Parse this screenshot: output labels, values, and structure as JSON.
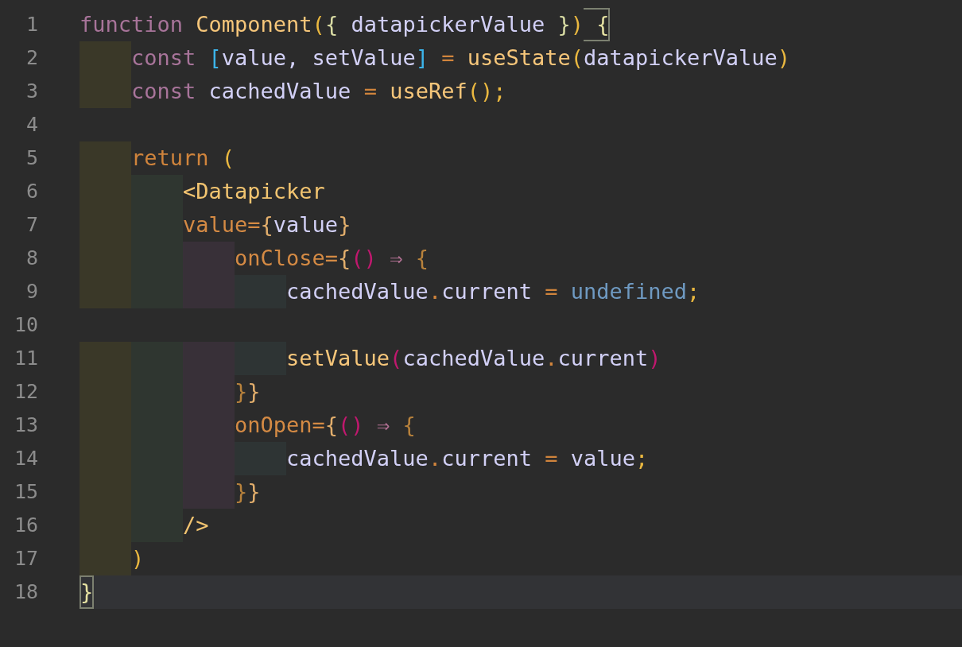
{
  "editor": {
    "lines": [
      {
        "number": "1",
        "current": false,
        "tokens": [
          {
            "text": "function",
            "kind": "keyword"
          },
          {
            "text": " Component",
            "kind": "function"
          },
          {
            "text": "(",
            "kind": "paren"
          },
          {
            "text": "{",
            "kind": "brace-pale"
          },
          {
            "text": " datapickerValue ",
            "kind": "variable"
          },
          {
            "text": "}",
            "kind": "brace-pale"
          },
          {
            "text": ")",
            "kind": "paren"
          },
          {
            "text": " {",
            "kind": "brace-match"
          }
        ]
      },
      {
        "number": "2",
        "current": false,
        "guides": [
          {
            "color": "#3a3828"
          }
        ],
        "tokens": [
          {
            "text": "const",
            "kind": "keyword"
          },
          {
            "text": " [",
            "kind": "bracket"
          },
          {
            "text": "value, setValue",
            "kind": "variable"
          },
          {
            "text": "]",
            "kind": "bracket"
          },
          {
            "text": " =",
            "kind": "operator"
          },
          {
            "text": " useState",
            "kind": "function"
          },
          {
            "text": "(",
            "kind": "paren"
          },
          {
            "text": "datapickerValue",
            "kind": "variable"
          },
          {
            "text": ")",
            "kind": "paren"
          }
        ]
      },
      {
        "number": "3",
        "current": false,
        "guides": [
          {
            "color": "#3a3828"
          }
        ],
        "tokens": [
          {
            "text": "const",
            "kind": "keyword"
          },
          {
            "text": " cachedValue",
            "kind": "variable"
          },
          {
            "text": " =",
            "kind": "operator"
          },
          {
            "text": " useRef",
            "kind": "function"
          },
          {
            "text": "();",
            "kind": "paren"
          }
        ]
      },
      {
        "number": "4",
        "current": false
      },
      {
        "number": "5",
        "current": false,
        "guides": [
          {
            "color": "#3a3828"
          }
        ],
        "tokens": [
          {
            "text": "return",
            "kind": "control"
          },
          {
            "text": " (",
            "kind": "paren"
          }
        ]
      },
      {
        "number": "6",
        "current": false,
        "guides": [
          {
            "color": "#3a3828"
          },
          {
            "color": "#2f3630"
          }
        ],
        "tokens": [
          {
            "text": "<Datapicker",
            "kind": "tag"
          }
        ]
      },
      {
        "number": "7",
        "current": false,
        "guides": [
          {
            "color": "#3a3828"
          },
          {
            "color": "#2f3630"
          }
        ],
        "tokens": [
          {
            "text": "value=",
            "kind": "attribute"
          },
          {
            "text": "{",
            "kind": "brace"
          },
          {
            "text": "value",
            "kind": "variable"
          },
          {
            "text": "}",
            "kind": "brace"
          }
        ]
      },
      {
        "number": "8",
        "current": false,
        "guides": [
          {
            "color": "#3a3828"
          },
          {
            "color": "#2f3630"
          },
          {
            "color": "#383038"
          }
        ],
        "tokens": [
          {
            "text": "onClose=",
            "kind": "attribute"
          },
          {
            "text": "{",
            "kind": "brace"
          },
          {
            "text": "()",
            "kind": "paren-magenta"
          },
          {
            "text": " ⇒",
            "kind": "arrow"
          },
          {
            "text": " {",
            "kind": "brace-dark"
          }
        ]
      },
      {
        "number": "9",
        "current": false,
        "guides": [
          {
            "color": "#3a3828"
          },
          {
            "color": "#2f3630"
          },
          {
            "color": "#383038"
          },
          {
            "color": "#2e3434"
          }
        ],
        "tokens": [
          {
            "text": "cachedValue",
            "kind": "variable"
          },
          {
            "text": ".",
            "kind": "operator"
          },
          {
            "text": "current",
            "kind": "variable"
          },
          {
            "text": " =",
            "kind": "operator"
          },
          {
            "text": " undefined",
            "kind": "constant"
          },
          {
            "text": ";",
            "kind": "paren"
          }
        ]
      },
      {
        "number": "10",
        "current": false
      },
      {
        "number": "11",
        "current": false,
        "guides": [
          {
            "color": "#3a3828"
          },
          {
            "color": "#2f3630"
          },
          {
            "color": "#383038"
          },
          {
            "color": "#2e3434"
          }
        ],
        "tokens": [
          {
            "text": "setValue",
            "kind": "function"
          },
          {
            "text": "(",
            "kind": "paren-magenta"
          },
          {
            "text": "cachedValue",
            "kind": "variable"
          },
          {
            "text": ".",
            "kind": "operator"
          },
          {
            "text": "current",
            "kind": "variable"
          },
          {
            "text": ")",
            "kind": "paren-magenta"
          }
        ]
      },
      {
        "number": "12",
        "current": false,
        "guides": [
          {
            "color": "#3a3828"
          },
          {
            "color": "#2f3630"
          },
          {
            "color": "#383038"
          }
        ],
        "tokens": [
          {
            "text": "}",
            "kind": "brace-dark"
          },
          {
            "text": "}",
            "kind": "brace"
          }
        ]
      },
      {
        "number": "13",
        "current": false,
        "guides": [
          {
            "color": "#3a3828"
          },
          {
            "color": "#2f3630"
          },
          {
            "color": "#383038"
          }
        ],
        "tokens": [
          {
            "text": "onOpen=",
            "kind": "attribute"
          },
          {
            "text": "{",
            "kind": "brace"
          },
          {
            "text": "()",
            "kind": "paren-magenta"
          },
          {
            "text": " ⇒",
            "kind": "arrow"
          },
          {
            "text": " {",
            "kind": "brace-dark"
          }
        ]
      },
      {
        "number": "14",
        "current": false,
        "guides": [
          {
            "color": "#3a3828"
          },
          {
            "color": "#2f3630"
          },
          {
            "color": "#383038"
          },
          {
            "color": "#2e3434"
          }
        ],
        "tokens": [
          {
            "text": "cachedValue",
            "kind": "variable"
          },
          {
            "text": ".",
            "kind": "operator"
          },
          {
            "text": "current",
            "kind": "variable"
          },
          {
            "text": " =",
            "kind": "operator"
          },
          {
            "text": " value",
            "kind": "variable"
          },
          {
            "text": ";",
            "kind": "paren"
          }
        ]
      },
      {
        "number": "15",
        "current": false,
        "guides": [
          {
            "color": "#3a3828"
          },
          {
            "color": "#2f3630"
          },
          {
            "color": "#383038"
          }
        ],
        "tokens": [
          {
            "text": "}",
            "kind": "brace-dark"
          },
          {
            "text": "}",
            "kind": "brace"
          }
        ]
      },
      {
        "number": "16",
        "current": false,
        "guides": [
          {
            "color": "#3a3828"
          },
          {
            "color": "#2f3630"
          }
        ],
        "tokens": [
          {
            "text": "/>",
            "kind": "tag"
          }
        ]
      },
      {
        "number": "17",
        "current": false,
        "guides": [
          {
            "color": "#3a3828"
          }
        ],
        "tokens": [
          {
            "text": ")",
            "kind": "paren"
          }
        ]
      },
      {
        "number": "18",
        "current": true,
        "tokens": [
          {
            "text": "}",
            "kind": "brace-match"
          }
        ]
      }
    ]
  }
}
